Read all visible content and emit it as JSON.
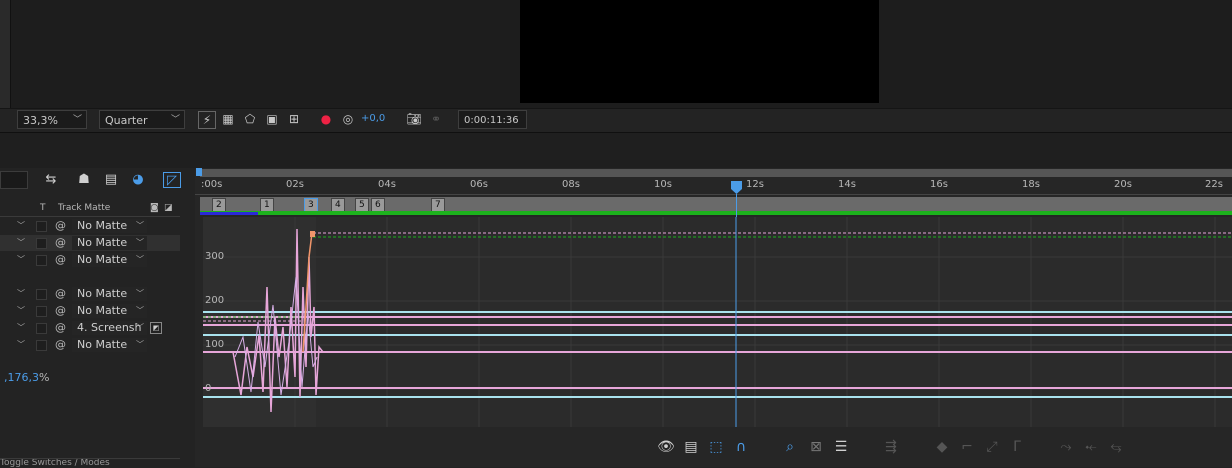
{
  "viewer": {
    "zoom": "33,3%",
    "resolution": "Quarter",
    "exposure": "+0,0",
    "timecode": "0:00:11:36",
    "icons": [
      "fast-preview-icon",
      "transparency-grid-icon",
      "mask-visibility-icon",
      "region-of-interest-icon",
      "guides-icon",
      "channel-icon",
      "color-management-icon",
      "snapshot-icon",
      "show-snapshot-icon"
    ]
  },
  "timeline": {
    "columns": {
      "t": "T",
      "track_matte": "Track Matte"
    },
    "layers": [
      {
        "matte": "No Matte",
        "highlight": false
      },
      {
        "matte": "No Matte",
        "highlight": true
      },
      {
        "matte": "No Matte",
        "highlight": false
      },
      {
        "matte": "No Matte",
        "highlight": false
      },
      {
        "matte": "No Matte",
        "highlight": false
      },
      {
        "matte": "4. Screensh",
        "highlight": false
      },
      {
        "matte": "No Matte",
        "highlight": false
      }
    ],
    "value_readout": ",176,3",
    "value_unit": "%",
    "bottom_tab": "Toggle Switches / Modes",
    "ruler_ticks": [
      ":00s",
      "02s",
      "04s",
      "06s",
      "08s",
      "10s",
      "12s",
      "14s",
      "16s",
      "18s",
      "20s",
      "22s"
    ],
    "markers": [
      "2",
      "1",
      "3",
      "4",
      "5",
      "6",
      "7"
    ],
    "y_labels": [
      "300",
      "200",
      "100",
      "0"
    ],
    "playhead_seconds": 11.6,
    "colors": {
      "accent": "#4b9ce8",
      "graph_pink": "#e7a6d9",
      "graph_cyan": "#a9e3ee",
      "graph_orange": "#f0956a",
      "work_green": "#1db21d",
      "work_blue": "#2a2ad8"
    }
  }
}
